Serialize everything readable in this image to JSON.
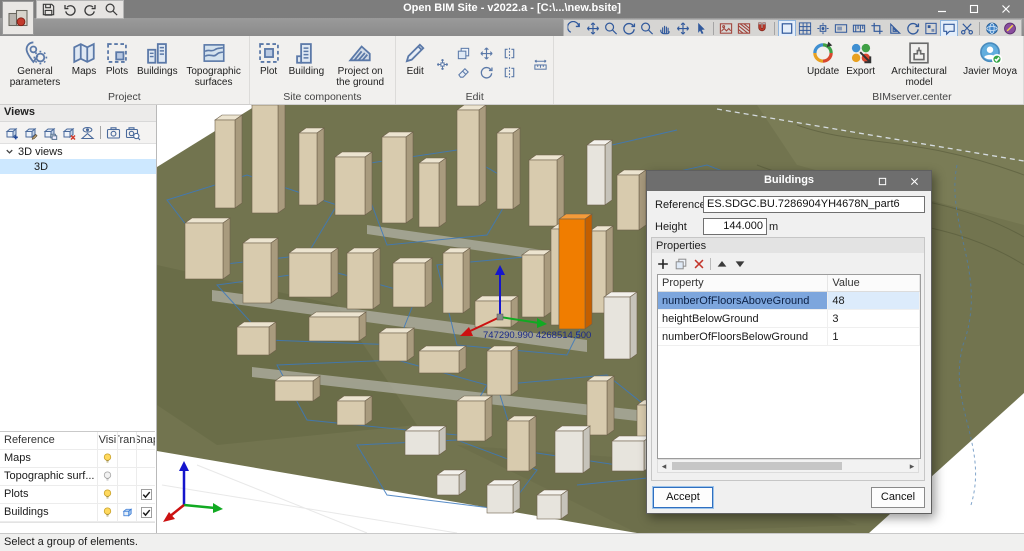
{
  "title_bar": {
    "title": "Open BIM Site - v2022.a - [C:\\...\\new.bsite]"
  },
  "quick_access": {
    "icons": [
      "save",
      "undo",
      "redo",
      "zoom"
    ]
  },
  "view_toolbar": {
    "icons": [
      "view-previous",
      "zoom-extents",
      "zoom",
      "orbit",
      "zoom-window",
      "pan",
      "move-view",
      "select-window",
      "|",
      "image-edit",
      "image-mask",
      "snap-magnet",
      "|",
      "ortho-mode",
      "grid",
      "snap-point",
      "work-planes",
      "dimensions",
      "clipping",
      "set-square",
      "rotate-view",
      "layer-palette",
      "comments",
      "cut",
      "|",
      "web-globe",
      "help-book"
    ],
    "selected": [
      "ortho-mode",
      "comments"
    ]
  },
  "ribbon": {
    "groups": [
      {
        "label": "Project",
        "buttons": [
          {
            "label": "General parameters",
            "icon": "pin-gear"
          },
          {
            "label": "Maps",
            "icon": "map"
          },
          {
            "label": "Plots",
            "icon": "plot"
          },
          {
            "label": "Buildings",
            "icon": "buildings"
          },
          {
            "label": "Topographic surfaces",
            "icon": "topo"
          }
        ]
      },
      {
        "label": "Site components",
        "buttons": [
          {
            "label": "Plot",
            "icon": "site-plot"
          },
          {
            "label": "Building",
            "icon": "site-building"
          },
          {
            "label": "Project on the ground",
            "icon": "ground"
          }
        ]
      },
      {
        "label": "Edit",
        "buttons": [
          {
            "label": "Edit",
            "icon": "pencil"
          }
        ],
        "tools": [
          "edit-node",
          "copy",
          "move",
          "mirror-h",
          "erase",
          "rotate",
          "mirror-v",
          "measure"
        ]
      },
      {
        "label": "BIMserver.center",
        "buttons": [
          {
            "label": "Update",
            "icon": "update"
          },
          {
            "label": "Export",
            "icon": "export"
          },
          {
            "label": "Architectural model",
            "icon": "arch"
          },
          {
            "label": "Javier Moya",
            "icon": "avatar"
          }
        ]
      }
    ]
  },
  "views_panel": {
    "header": "Views",
    "toolbar": [
      "new-view",
      "edit-view",
      "duplicate-view",
      "delete-view",
      "view-orientation",
      "|",
      "capture",
      "capture-zoom"
    ],
    "group": "3D views",
    "item": "3D"
  },
  "layers_table": {
    "headers": [
      "Reference",
      "Visi",
      "Trans",
      "Snap"
    ],
    "rows": [
      {
        "reference": "Maps",
        "visible": true,
        "transparent": false,
        "snap": false
      },
      {
        "reference": "Topographic surf...",
        "visible": false,
        "transparent": false,
        "snap": false
      },
      {
        "reference": "Plots",
        "visible": true,
        "transparent": false,
        "snap": true
      },
      {
        "reference": "Buildings",
        "visible": true,
        "transparent": true,
        "snap": true
      }
    ]
  },
  "viewport": {
    "coordinates": "747290.990  4268514.500"
  },
  "dialog": {
    "title": "Buildings",
    "reference_label": "Reference",
    "reference_value": "ES.SDGC.BU.7286904YH4678N_part6",
    "height_label": "Height",
    "height_value": "144.000",
    "height_unit": "m",
    "properties_label": "Properties",
    "table": {
      "headers": [
        "Property",
        "Value"
      ],
      "rows": [
        [
          "numberOfFloorsAboveGround",
          "48"
        ],
        [
          "heightBelowGround",
          "3"
        ],
        [
          "numberOfFloorsBelowGround",
          "1"
        ]
      ],
      "selected_index": 0
    },
    "accept_label": "Accept",
    "cancel_label": "Cancel"
  },
  "status_bar": {
    "text": "Select a group of elements."
  },
  "colors": {
    "selection_blue": "#7da6dd",
    "terrain_olive": "#72744f",
    "building_beige": "#d8cbae",
    "plot_line_blue": "#3c79bd",
    "highlight_orange": "#f07d00",
    "axis_x_red": "#cc1111",
    "axis_y_green": "#11aa22",
    "axis_z_blue": "#1515cc"
  }
}
